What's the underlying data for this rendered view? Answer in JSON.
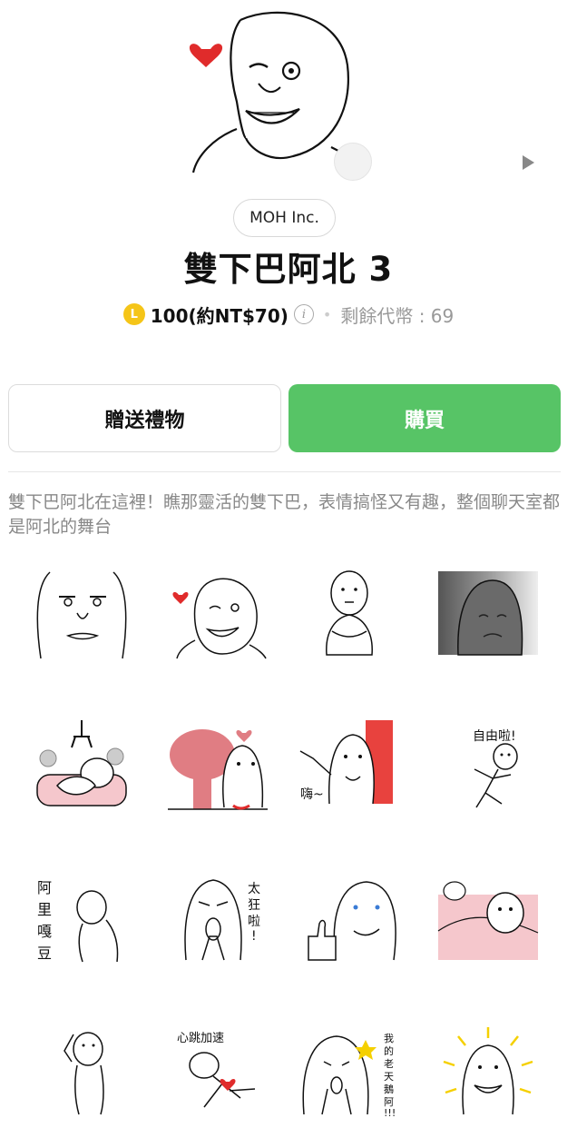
{
  "product": {
    "author": "MOH Inc.",
    "title": "雙下巴阿北 3",
    "coin_symbol": "L",
    "price": "100(約NT$70)",
    "info_symbol": "i",
    "separator": "•",
    "balance": "剩餘代幣 : 69",
    "description": "雙下巴阿北在這裡！瞧那靈活的雙下巴，表情搞怪又有趣，整個聊天室都是阿北的舞台"
  },
  "actions": {
    "gift_label": "贈送禮物",
    "buy_label": "購買"
  },
  "colors": {
    "buy_green": "#57c466",
    "coin_gold": "#f5c518",
    "heart_red": "#e02b2b",
    "text_gray": "#888888"
  },
  "stickers": [
    {
      "name": "stare-face",
      "text": ""
    },
    {
      "name": "heart-wink",
      "text": ""
    },
    {
      "name": "sitting-hug-knees",
      "text": ""
    },
    {
      "name": "gloomy-dark",
      "text": ""
    },
    {
      "name": "claw-machine",
      "text": ""
    },
    {
      "name": "mushroom-cloud",
      "text": ""
    },
    {
      "name": "curtain-wave",
      "text": "嗨~"
    },
    {
      "name": "running-free",
      "text": "自由啦!"
    },
    {
      "name": "bow-apology",
      "text": "阿里嘎豆"
    },
    {
      "name": "praying-cry",
      "text": "太狂啦!"
    },
    {
      "name": "thumbs-up",
      "text": ""
    },
    {
      "name": "sleeping-bed",
      "text": ""
    },
    {
      "name": "salute",
      "text": ""
    },
    {
      "name": "heartbeat",
      "text": "心跳加速"
    },
    {
      "name": "shocked-hands",
      "text": "我的老天鵝阿!!!"
    },
    {
      "name": "shining-grin",
      "text": ""
    }
  ]
}
